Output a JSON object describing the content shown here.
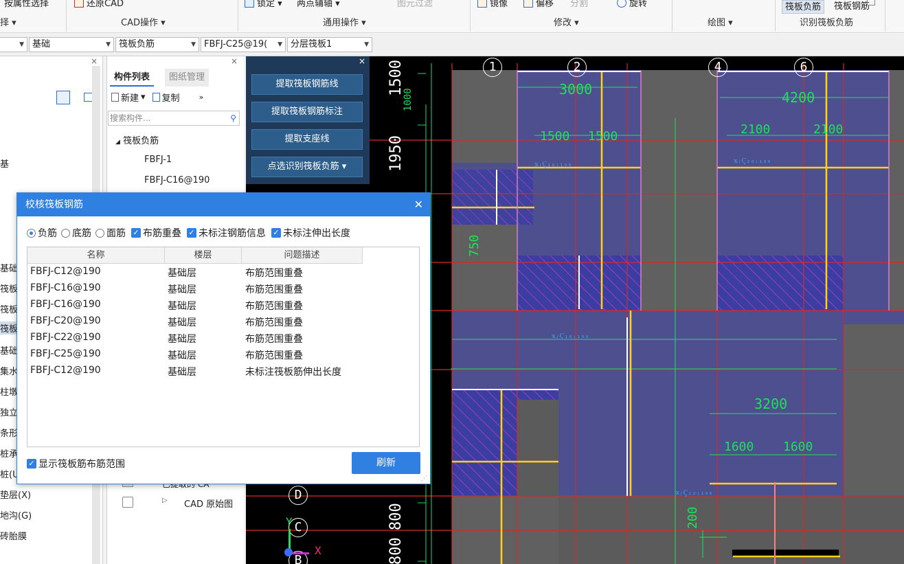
{
  "ribbon": {
    "items": [
      {
        "label": "按属性选择",
        "disabled": false
      },
      {
        "label": "还原CAD",
        "disabled": false
      },
      {
        "label": "锁定 ▾",
        "disabled": false
      },
      {
        "label": "两点辅轴 ▾",
        "disabled": false
      },
      {
        "label": "图元过滤",
        "disabled": true
      },
      {
        "label": "镜像",
        "disabled": false
      },
      {
        "label": "偏移",
        "disabled": false
      },
      {
        "label": "分割",
        "disabled": true
      },
      {
        "label": "旋转",
        "disabled": false
      }
    ],
    "groups": [
      "择 ▾",
      "CAD操作 ▾",
      "通用操作 ▾",
      "修改 ▾",
      "绘图 ▾",
      "识别筏板负筋"
    ],
    "tabs": [
      "筏板负筋",
      "筏板钢筋"
    ]
  },
  "selector": {
    "floor": "",
    "category": "基础",
    "type": "筏板负筋",
    "component": "FBFJ-C25@19(",
    "layer": "分层筏板1"
  },
  "left_tree": {
    "items": [
      "基础",
      "筏板",
      "筏板",
      "筏板",
      "基础",
      "集水",
      "柱墩",
      "独立",
      "条形",
      "桩承",
      "桩(U",
      "垫层(X)",
      "地沟(G)",
      "砖胎膜"
    ],
    "partial_top": "基"
  },
  "component_list": {
    "tabs": [
      "构件列表",
      "图纸管理"
    ],
    "new_label": "新建",
    "copy_label": "复制",
    "search_placeholder": "搜索构件...",
    "group_label": "筏板负筋",
    "items": [
      "FBFJ-1",
      "FBFJ-C16@190"
    ],
    "bottom_rows": [
      "已提取的 CA",
      "CAD 原始图"
    ]
  },
  "identify_panel": {
    "buttons": [
      "提取筏板钢筋线",
      "提取筏板钢筋标注",
      "提取支座线",
      "点选识别筏板负筋 ▾"
    ]
  },
  "dialog": {
    "title": "校核筏板钢筋",
    "options": {
      "radios": [
        {
          "label": "负筋",
          "checked": true
        },
        {
          "label": "底筋",
          "checked": false
        },
        {
          "label": "面筋",
          "checked": false
        }
      ],
      "checks": [
        "布筋重叠",
        "未标注钢筋信息",
        "未标注伸出长度"
      ]
    },
    "columns": [
      "名称",
      "楼层",
      "问题描述"
    ],
    "rows": [
      [
        "FBFJ-C12@190",
        "基础层",
        "布筋范围重叠"
      ],
      [
        "FBFJ-C16@190",
        "基础层",
        "布筋范围重叠"
      ],
      [
        "FBFJ-C16@190",
        "基础层",
        "布筋范围重叠"
      ],
      [
        "FBFJ-C20@190",
        "基础层",
        "布筋范围重叠"
      ],
      [
        "FBFJ-C22@190",
        "基础层",
        "布筋范围重叠"
      ],
      [
        "FBFJ-C25@190",
        "基础层",
        "布筋范围重叠"
      ],
      [
        "FBFJ-C12@190",
        "基础层",
        "未标注筏板筋伸出长度"
      ]
    ],
    "show_range_label": "显示筏板筋布筋范围",
    "refresh_label": "刷新"
  },
  "cad": {
    "axis_numbers": [
      "1",
      "2",
      "4",
      "6"
    ],
    "axis_letters": [
      "D",
      "C",
      "B"
    ],
    "dims": {
      "left": [
        "1500",
        "1950",
        "800",
        "800"
      ],
      "top": [
        "3000",
        "4200",
        "3200",
        "1500",
        "1500",
        "2100",
        "2100",
        "1600",
        "1600"
      ],
      "misc": [
        "750",
        "1000",
        "200"
      ]
    },
    "ucs": {
      "y": "Y",
      "x": "X"
    }
  },
  "colors": {
    "accent": "#2f80e0",
    "cad_bg": "#000000",
    "slab": "#4e4f8f",
    "concrete": "#606060",
    "rebar": "#ffd21f",
    "grid_red": "#d42a2a",
    "dim_green": "#1ee05a"
  }
}
